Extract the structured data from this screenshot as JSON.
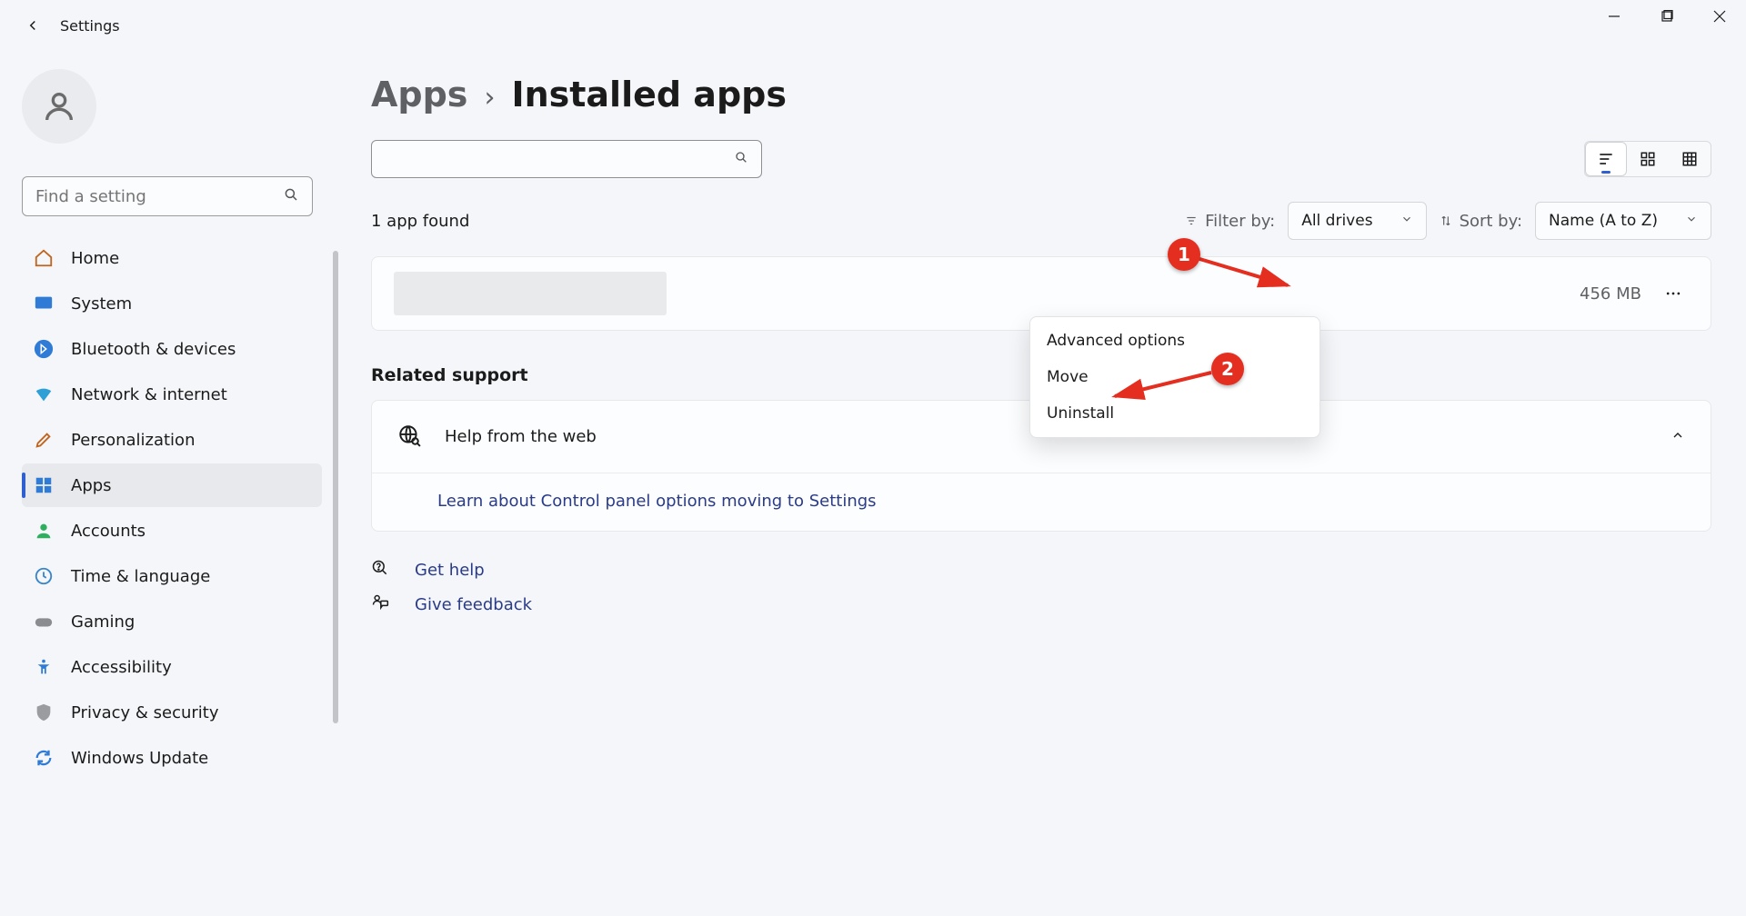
{
  "window": {
    "title": "Settings"
  },
  "sidebar": {
    "find_setting_placeholder": "Find a setting",
    "items": [
      {
        "label": "Home"
      },
      {
        "label": "System"
      },
      {
        "label": "Bluetooth & devices"
      },
      {
        "label": "Network & internet"
      },
      {
        "label": "Personalization"
      },
      {
        "label": "Apps"
      },
      {
        "label": "Accounts"
      },
      {
        "label": "Time & language"
      },
      {
        "label": "Gaming"
      },
      {
        "label": "Accessibility"
      },
      {
        "label": "Privacy & security"
      },
      {
        "label": "Windows Update"
      }
    ],
    "active_index": 5
  },
  "breadcrumb": {
    "parent": "Apps",
    "separator": "›",
    "current": "Installed apps"
  },
  "filters": {
    "result_count": "1 app found",
    "filter_label": "Filter by:",
    "filter_value": "All drives",
    "sort_label": "Sort by:",
    "sort_value": "Name (A to Z)"
  },
  "app_entry": {
    "size": "456 MB"
  },
  "context_menu": {
    "items": [
      "Advanced options",
      "Move",
      "Uninstall"
    ]
  },
  "support": {
    "heading": "Related support",
    "help_web": "Help from the web",
    "link1": "Learn about Control panel options moving to Settings"
  },
  "footer": {
    "get_help": "Get help",
    "feedback": "Give feedback"
  },
  "annotations": {
    "badge1": "1",
    "badge2": "2"
  }
}
